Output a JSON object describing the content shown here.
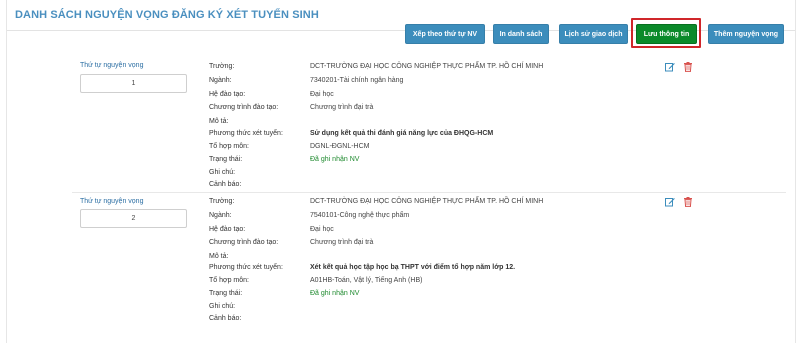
{
  "page": {
    "title": "DANH SÁCH NGUYỆN VỌNG ĐĂNG KÝ XÉT TUYỂN SINH"
  },
  "toolbar": {
    "sort_label": "Xếp theo thứ tự NV",
    "print_label": "In danh sách",
    "history_label": "Lịch sử giao dịch",
    "save_label": "Lưu thông tin",
    "add_label": "Thêm nguyện vọng"
  },
  "labels": {
    "pref_order": "Thứ tự nguyện vọng",
    "school": "Trường:",
    "major": "Ngành:",
    "training_system": "Hệ đào tạo:",
    "program": "Chương trình đào tạo:",
    "description": "Mô tả:",
    "method": "Phương thức xét tuyển:",
    "subject_group": "Tổ hợp môn:",
    "status": "Trạng thái:",
    "note": "Ghi chú:",
    "warning": "Cảnh báo:"
  },
  "wishes": [
    {
      "order": "1",
      "school": "DCT-TRƯỜNG ĐẠI HỌC CÔNG NGHIỆP THỰC PHẨM TP. HỒ CHÍ MINH",
      "major": "7340201-Tài chính ngân hàng",
      "training_system": "Đại học",
      "program": "Chương trình đại trà",
      "description": "",
      "method": "Sử dụng kết quả thi đánh giá năng lực của ĐHQG-HCM",
      "subject_group": "DGNL-ĐGNL-HCM",
      "status": "Đã ghi nhận NV",
      "note": "",
      "warning": ""
    },
    {
      "order": "2",
      "school": "DCT-TRƯỜNG ĐẠI HỌC CÔNG NGHIỆP THỰC PHẨM TP. HỒ CHÍ MINH",
      "major": "7540101-Công nghệ thực phẩm",
      "training_system": "Đại học",
      "program": "Chương trình đại trà",
      "description": "",
      "method": "Xét kết quả học tập học bạ THPT với điểm tổ hợp năm lớp 12.",
      "subject_group": "A01HB-Toán, Vật lý, Tiếng Anh (HB)",
      "status": "Đã ghi nhận NV",
      "note": "",
      "warning": ""
    }
  ],
  "icons": {
    "edit": "edit-icon",
    "delete": "trash-icon"
  },
  "colors": {
    "primary_button": "#3c8dbc",
    "save_button": "#0b8a2a",
    "highlight": "#d0262a",
    "status_green": "#1e8a2e",
    "title": "#4a8fbf"
  }
}
